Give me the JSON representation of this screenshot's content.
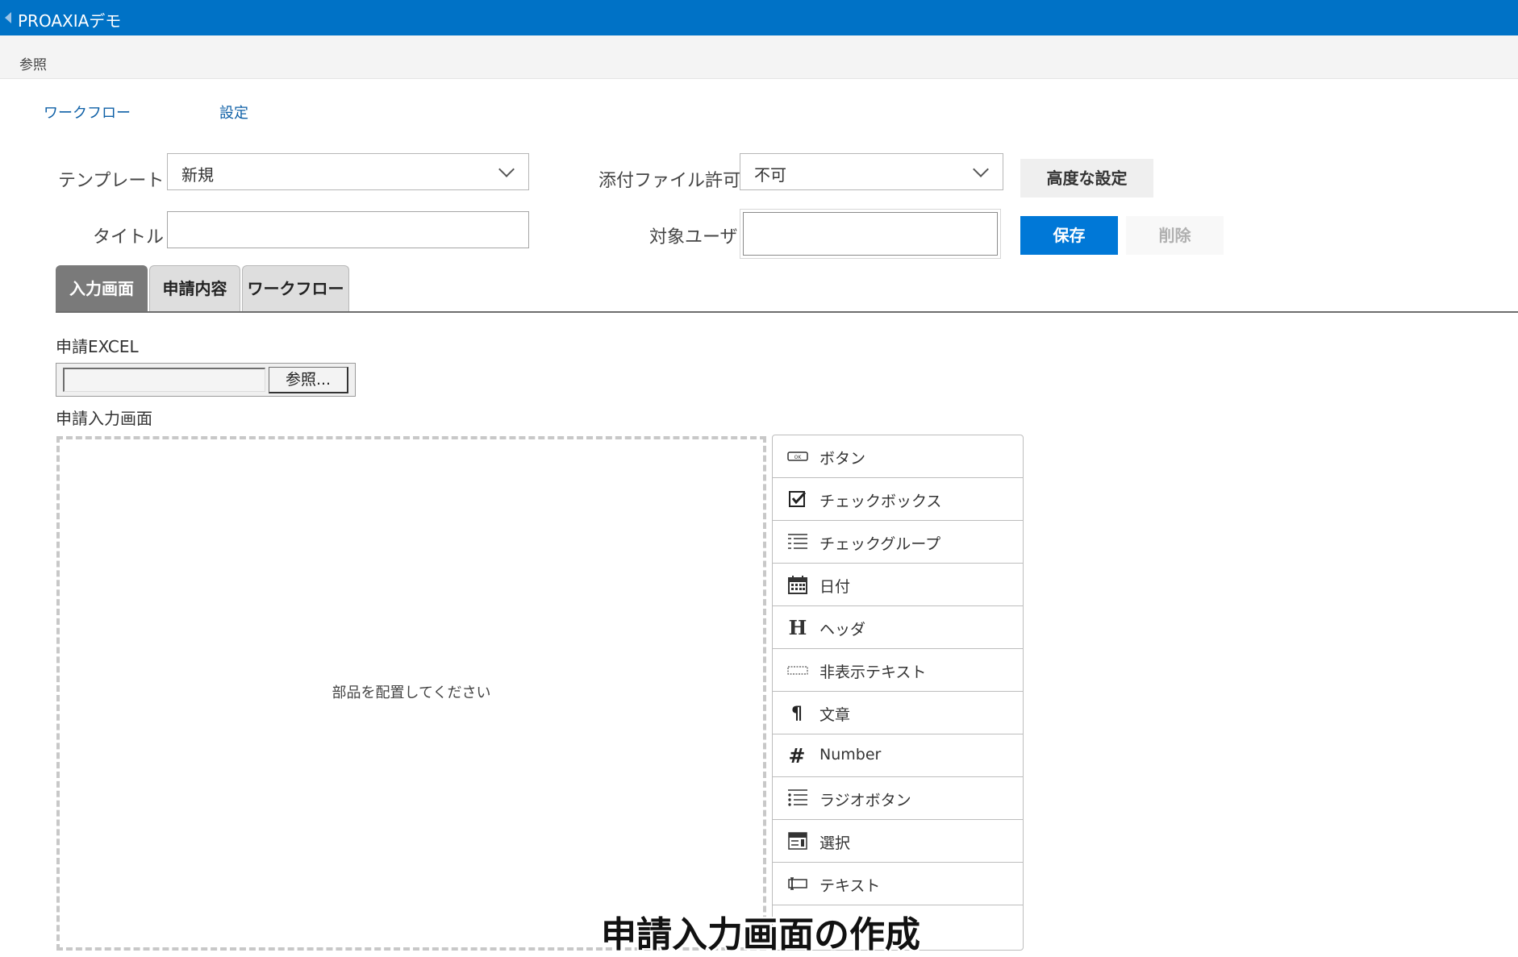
{
  "app": {
    "title": "PROAXIAデモ"
  },
  "ribbon": {
    "tab": "参照"
  },
  "nav": {
    "items": [
      "ワークフロー",
      "設定"
    ]
  },
  "form": {
    "template_label": "テンプレート",
    "template_value": "新規",
    "title_label": "タイトル",
    "title_value": "",
    "attach_label": "添付ファイル許可",
    "attach_value": "不可",
    "target_label": "対象ユーザ",
    "target_value": "",
    "advanced_button": "高度な設定",
    "save_button": "保存",
    "delete_button": "削除"
  },
  "tabs": [
    "入力画面",
    "申請内容",
    "ワークフロー"
  ],
  "excel": {
    "label": "申請EXCEL",
    "browse_button": "参照..."
  },
  "input_screen": {
    "label": "申請入力画面",
    "drop_hint": "部品を配置してください"
  },
  "palette": {
    "items": [
      {
        "label": "ボタン",
        "icon": "button-icon"
      },
      {
        "label": "チェックボックス",
        "icon": "checkbox-icon"
      },
      {
        "label": "チェックグループ",
        "icon": "check-group-icon"
      },
      {
        "label": "日付",
        "icon": "calendar-icon"
      },
      {
        "label": "ヘッダ",
        "icon": "header-icon"
      },
      {
        "label": "非表示テキスト",
        "icon": "hidden-text-icon"
      },
      {
        "label": "文章",
        "icon": "paragraph-icon"
      },
      {
        "label": "Number",
        "icon": "number-icon"
      },
      {
        "label": "ラジオボタン",
        "icon": "radio-list-icon"
      },
      {
        "label": "選択",
        "icon": "select-icon"
      },
      {
        "label": "テキスト",
        "icon": "text-input-icon"
      }
    ]
  },
  "caption": "申請入力画面の作成"
}
